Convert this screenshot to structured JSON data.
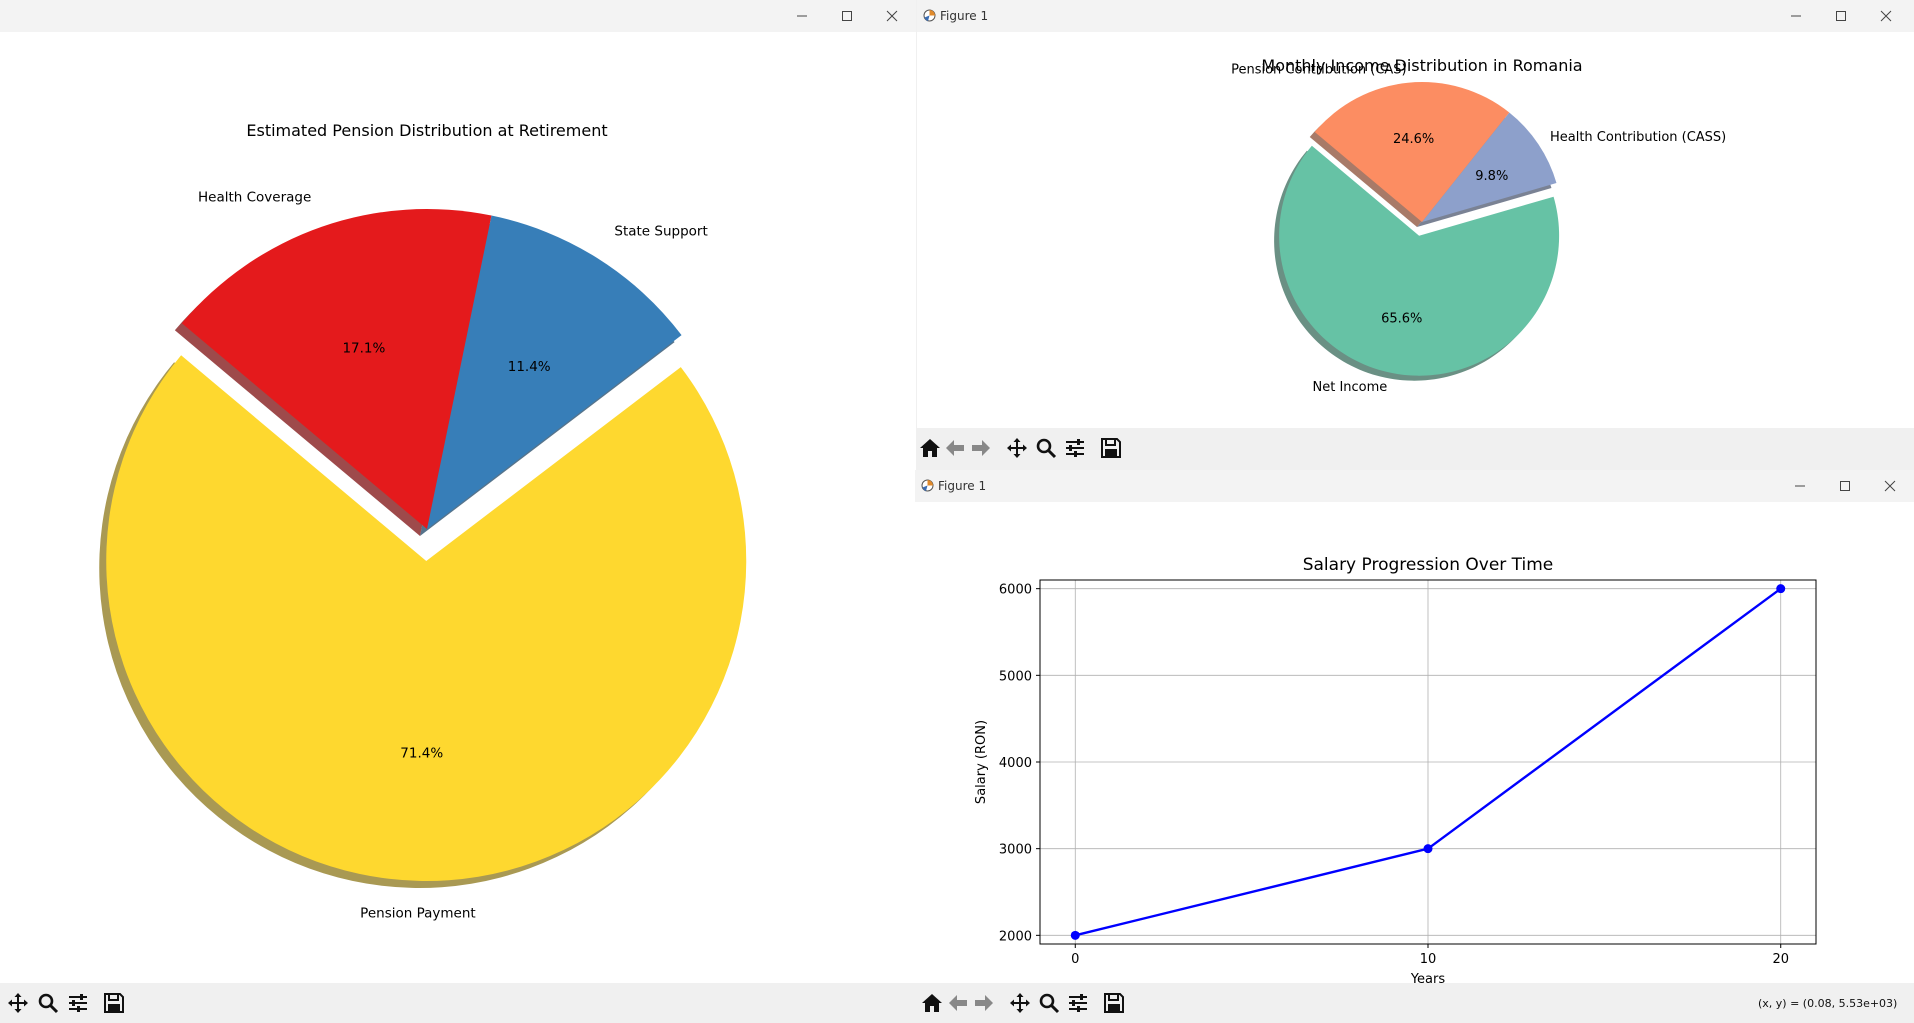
{
  "windows": {
    "left": {
      "title": "",
      "toolbar": [
        "pan-icon",
        "zoom-icon",
        "configure-icon",
        "save-icon"
      ]
    },
    "top_right": {
      "title": "Figure 1",
      "toolbar": [
        "home-icon",
        "back-icon",
        "forward-icon",
        "pan-icon",
        "zoom-icon",
        "configure-icon",
        "save-icon"
      ]
    },
    "bottom_right": {
      "title": "Figure 1",
      "toolbar": [
        "home-icon",
        "back-icon",
        "forward-icon",
        "pan-icon",
        "zoom-icon",
        "configure-icon",
        "save-icon"
      ],
      "status": "(x, y) = (0.08, 5.53e+03)"
    }
  },
  "chart_data": [
    {
      "type": "pie",
      "title": "Estimated Pension Distribution at Retirement",
      "labels": [
        "Pension Payment",
        "State Support",
        "Health Coverage"
      ],
      "values": [
        71.4,
        11.4,
        17.1
      ],
      "autopct": [
        "71.4%",
        "11.4%",
        "17.1%"
      ],
      "colors": [
        "#fed82f",
        "#377eb8",
        "#e41a1c"
      ],
      "explode": [
        0.1,
        0,
        0
      ],
      "shadow": true,
      "startangle": 140
    },
    {
      "type": "pie",
      "title": "Monthly Income Distribution in Romania",
      "labels": [
        "Net Income",
        "Health Contribution (CASS)",
        "Pension Contribution (CAS)"
      ],
      "values": [
        65.6,
        9.8,
        24.6
      ],
      "autopct": [
        "65.6%",
        "9.8%",
        "24.6%"
      ],
      "colors": [
        "#66c2a5",
        "#8da0cb",
        "#fc8d62"
      ],
      "explode": [
        0.1,
        0,
        0
      ],
      "shadow": true,
      "startangle": 140
    },
    {
      "type": "line",
      "title": "Salary Progression Over Time",
      "xlabel": "Years",
      "ylabel": "Salary (RON)",
      "x": [
        0,
        10,
        20
      ],
      "y": [
        2000,
        3000,
        6000
      ],
      "xticks": [
        0,
        10,
        20
      ],
      "yticks": [
        2000,
        3000,
        4000,
        5000,
        6000
      ],
      "xlim": [
        -1,
        21
      ],
      "ylim": [
        1900,
        6100
      ],
      "grid": true,
      "color": "#0000ff",
      "marker": "o"
    }
  ]
}
